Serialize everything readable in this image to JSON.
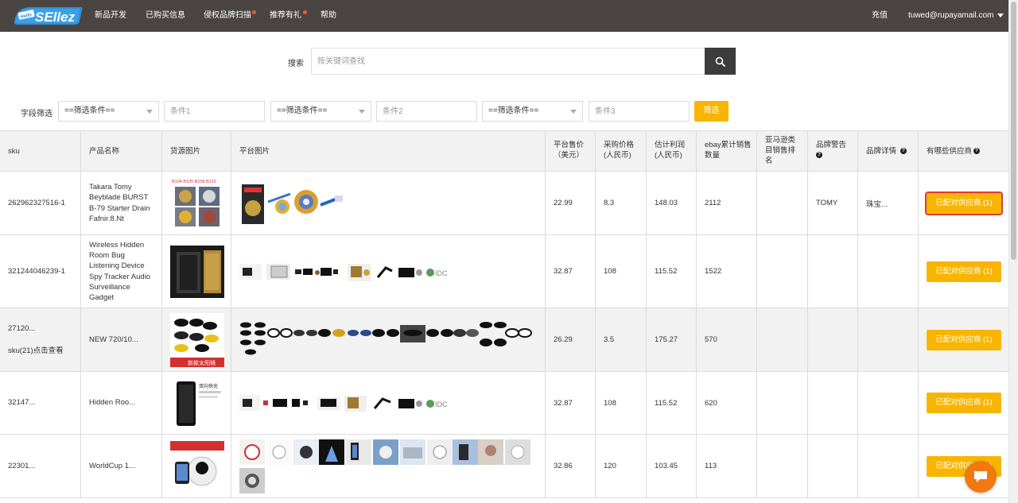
{
  "nav": {
    "logo_text": "SEllez",
    "logo_badge": "Hello",
    "items": [
      {
        "label": "新品开发",
        "dot": false
      },
      {
        "label": "已购买信息",
        "dot": false
      },
      {
        "label": "侵权品牌扫描",
        "dot": true
      },
      {
        "label": "推荐有礼",
        "dot": true
      },
      {
        "label": "帮助",
        "dot": false
      }
    ],
    "recharge": "充值",
    "user_email": "tuwed@rupayamail.com"
  },
  "search": {
    "label": "搜索",
    "placeholder": "按关键词查找"
  },
  "filters": {
    "label": "字段筛选",
    "select_1": "==筛选条件==",
    "cond_1_placeholder": "条件1",
    "select_2": "==筛选条件==",
    "cond_2_placeholder": "条件2",
    "select_3": "==筛选条件==",
    "cond_3_placeholder": "条件3",
    "button": "筛选"
  },
  "table": {
    "headers": {
      "sku": "sku",
      "name": "产品名称",
      "source_img": "货源图片",
      "platform_img": "平台图片",
      "price": "平台售价（美元）",
      "purchase": "采购价格(人民币)",
      "profit": "估计利润(人民币)",
      "sales": "ebay累计销售数量",
      "amazon_rank": "亚马逊类目销售排名",
      "brand_warning": "品牌警告",
      "brand_detail": "品牌详情",
      "suppliers": "有哪些供应商"
    },
    "rows": [
      {
        "sku": "262962327516-1",
        "sku_extra": "",
        "name": "Takara Tomy Beyblade BURST B-79 Starter Drain Fafnir.8.Nt",
        "price": "22.99",
        "purchase": "8.3",
        "profit": "148.03",
        "sales": "2112",
        "amazon_rank": "",
        "brand_warning": "TOMY",
        "brand_detail": "珠宝...",
        "supplier_btn": "已配对供应商 (1)",
        "source_caption": "B104 B105 B106 B110"
      },
      {
        "sku": "321244046239-1",
        "sku_extra": "",
        "name": "Wireless Hidden Room Bug Listening Device Spy Tracker Audio Surveillance Gadget",
        "price": "32.87",
        "purchase": "108",
        "profit": "115.52",
        "sales": "1522",
        "amazon_rank": "",
        "brand_warning": "",
        "brand_detail": "",
        "supplier_btn": "已配对供应商 (1)",
        "source_caption": ""
      },
      {
        "sku": "27120...",
        "sku_extra": "sku(21)点击查看",
        "name": "NEW 720/10...",
        "price": "26.29",
        "purchase": "3.5",
        "profit": "175.27",
        "sales": "570",
        "amazon_rank": "",
        "brand_warning": "",
        "brand_detail": "",
        "supplier_btn": "已配对供应商 (1)",
        "source_caption": "新款太阳镜"
      },
      {
        "sku": "32147...",
        "sku_extra": "",
        "name": "Hidden Roo...",
        "price": "32.87",
        "purchase": "108",
        "profit": "115.52",
        "sales": "620",
        "amazon_rank": "",
        "brand_warning": "",
        "brand_detail": "",
        "supplier_btn": "已配对供应商 (1)",
        "source_caption": "双向快充"
      },
      {
        "sku": "22301...",
        "sku_extra": "",
        "name": "WorldCup 1...",
        "price": "32.86",
        "purchase": "120",
        "profit": "103.45",
        "sales": "113",
        "amazon_rank": "",
        "brand_warning": "",
        "brand_detail": "",
        "supplier_btn": "已配对供应商 (1)",
        "source_caption": ""
      }
    ]
  },
  "colors": {
    "topbar": "#4a4542",
    "accent": "#f8b500",
    "highlight": "#e53935",
    "chat": "#f07a10"
  },
  "icons": {
    "search": "search-icon",
    "help": "question-circle-icon",
    "chat": "chat-bubble-icon",
    "caret": "caret-down-icon"
  }
}
